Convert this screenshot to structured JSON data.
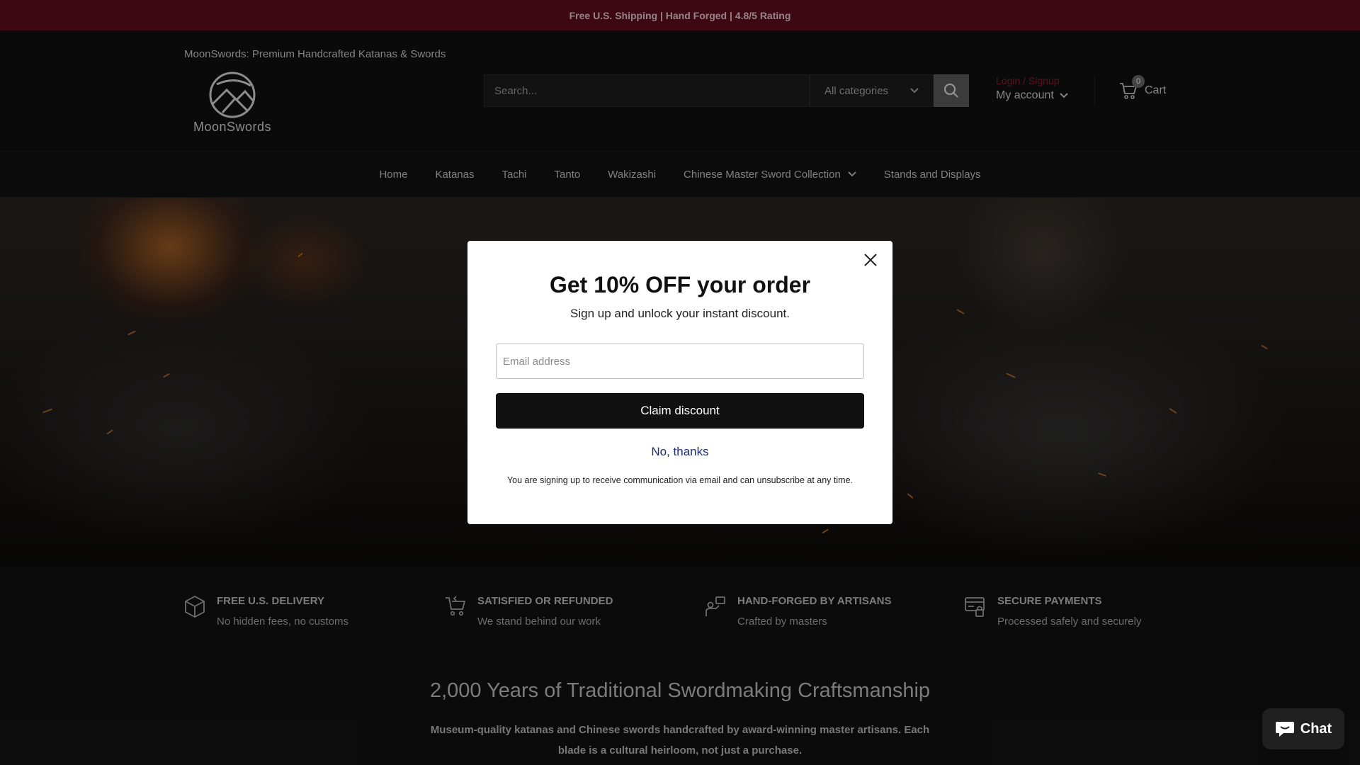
{
  "announcement": {
    "text": "Free U.S. Shipping | Hand Forged | 4.8/5 Rating"
  },
  "header": {
    "tagline": "MoonSwords: Premium Handcrafted Katanas & Swords",
    "logo_text": "MoonSwords",
    "search": {
      "placeholder": "Search...",
      "category": "All categories"
    },
    "account": {
      "login_label": "Login / Signup",
      "my_account_label": "My account"
    },
    "cart": {
      "count": "0",
      "label": "Cart"
    }
  },
  "nav": {
    "items": [
      {
        "label": "Home"
      },
      {
        "label": "Katanas"
      },
      {
        "label": "Tachi"
      },
      {
        "label": "Tanto"
      },
      {
        "label": "Wakizashi"
      },
      {
        "label": "Chinese Master Sword Collection"
      },
      {
        "label": "Stands and Displays"
      }
    ]
  },
  "features": [
    {
      "title": "FREE U.S. DELIVERY",
      "subtitle": "No hidden fees, no customs",
      "icon": "box-icon"
    },
    {
      "title": "SATISFIED OR REFUNDED",
      "subtitle": "We stand behind our work",
      "icon": "cart-return-icon"
    },
    {
      "title": "HAND-FORGED BY ARTISANS",
      "subtitle": "Crafted by masters",
      "icon": "artisan-icon"
    },
    {
      "title": "SECURE PAYMENTS",
      "subtitle": "Processed safely and securely",
      "icon": "secure-card-icon"
    }
  ],
  "intro": {
    "heading": "2,000 Years of Traditional Swordmaking Craftsmanship",
    "body": "Museum-quality katanas and Chinese swords handcrafted by award-winning master artisans. Each blade is a cultural heirloom, not just a purchase."
  },
  "popup": {
    "title": "Get 10% OFF your order",
    "subtitle": "Sign up and unlock your instant discount.",
    "email_placeholder": "Email address",
    "claim_label": "Claim discount",
    "decline_label": "No, thanks",
    "legal": "You are signing up to receive communication via email and can unsubscribe at any time."
  },
  "chat": {
    "label": "Chat"
  },
  "colors": {
    "announcement_bg": "#5e0d1e",
    "login_link": "#8a1f33",
    "decline_link": "#1e2a78"
  }
}
